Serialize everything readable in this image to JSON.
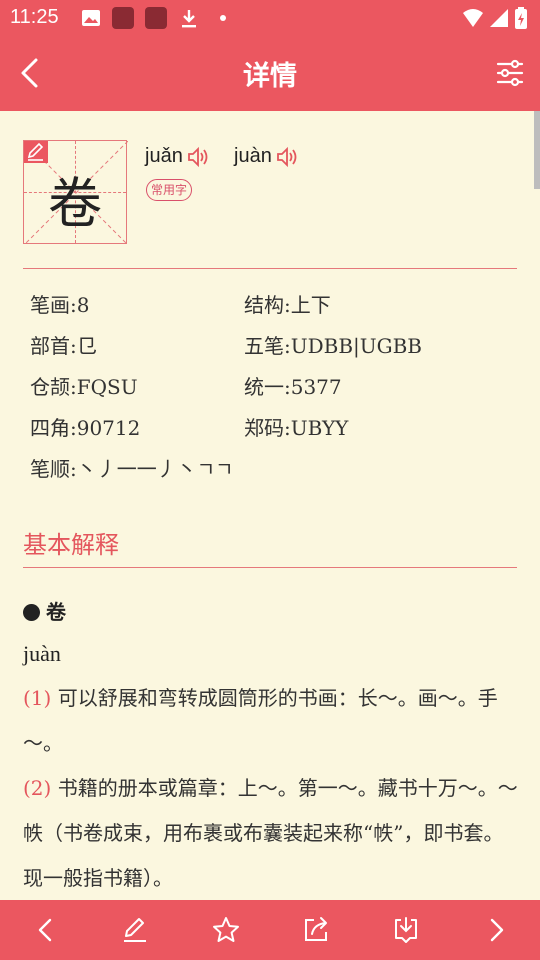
{
  "status_bar": {
    "time": "11:25"
  },
  "app_bar": {
    "title": "详情"
  },
  "character": {
    "glyph": "卷",
    "readings": [
      "juǎn",
      "juàn"
    ],
    "badge": "常用字"
  },
  "info": {
    "strokes": "笔画:8",
    "structure": "结构:上下",
    "radical": "部首:㔾",
    "wubi": "五笔:UDBB|UGBB",
    "cangjie": "仓颉:FQSU",
    "unicode": "统一:5377",
    "four_corner": "四角:90712",
    "zhengma": "郑码:UBYY",
    "stroke_order": "笔顺:丶丿一一丿丶ㄱㄱ"
  },
  "basic": {
    "section_title": "基本解释",
    "entry_char": "卷",
    "entry_pinyin": "juàn",
    "defs": [
      {
        "num": "(1)",
        "text": " 可以舒展和弯转成圆筒形的书画：长～。画～。手～。"
      },
      {
        "num": "(2)",
        "text": " 书籍的册本或篇章：上～。第一～。藏书十万～。～帙（书卷成束，用布裹或布囊装起来称“帙”，即书套。现一般指书籍）。"
      }
    ]
  },
  "colors": {
    "accent": "#eb5760",
    "background": "#fbf7df"
  },
  "icons": {
    "back": "back-icon",
    "filter": "filter-icon",
    "bottom": [
      "prev-icon",
      "edit-icon",
      "star-icon",
      "share-icon",
      "download-icon",
      "next-icon"
    ]
  }
}
